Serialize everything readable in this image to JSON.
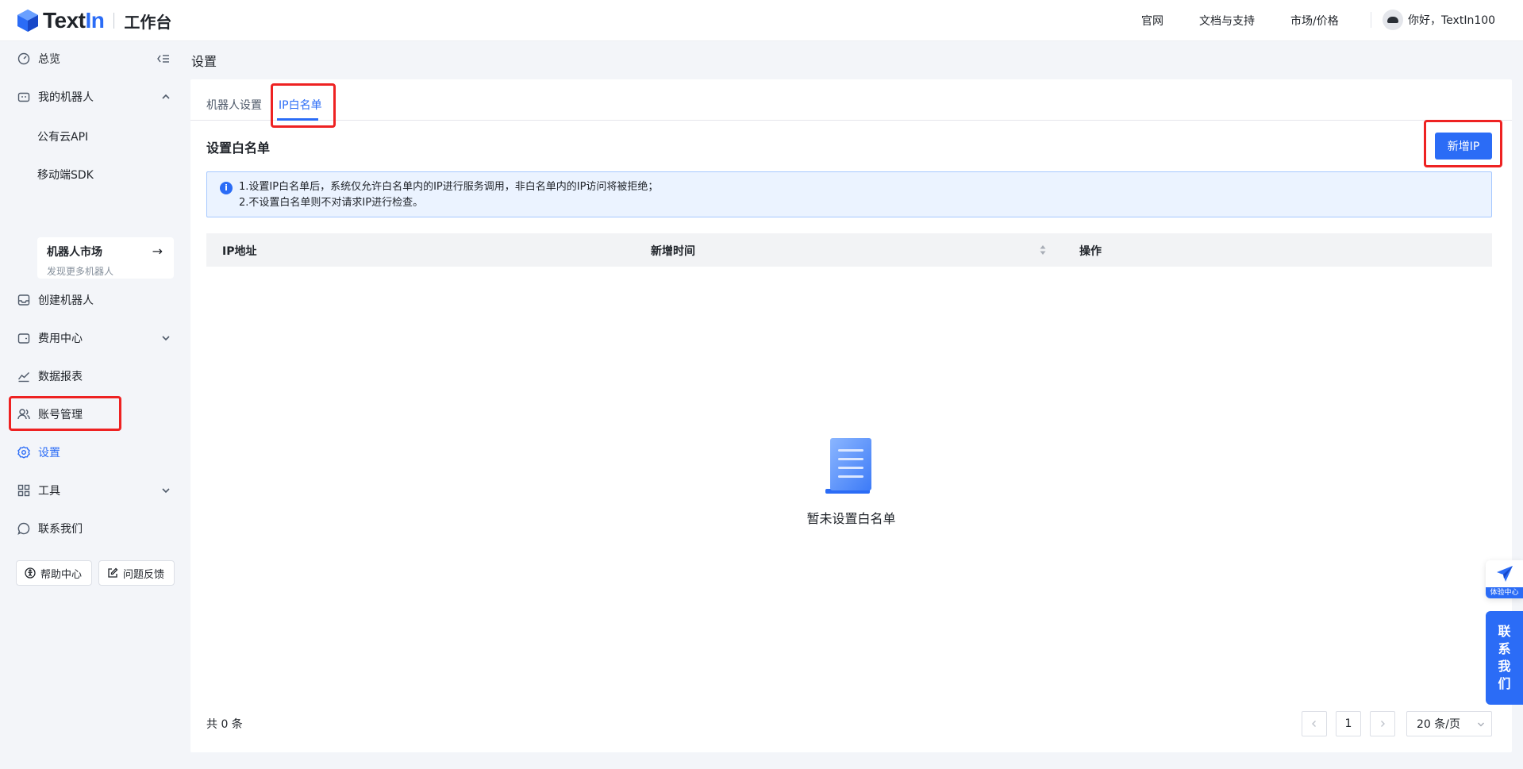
{
  "header": {
    "logo_text_1": "Text",
    "logo_text_2": "In",
    "workspace": "工作台",
    "nav": [
      "官网",
      "文档与支持",
      "市场/价格"
    ],
    "greeting": "你好，TextIn100"
  },
  "sidebar": {
    "overview": "总览",
    "my_robots": "我的机器人",
    "sub_items": [
      "公有云API",
      "移动端SDK"
    ],
    "market_title": "机器人市场",
    "market_sub": "发现更多机器人",
    "create_robot": "创建机器人",
    "billing": "费用中心",
    "reports": "数据报表",
    "accounts": "账号管理",
    "settings": "设置",
    "tools": "工具",
    "contact": "联系我们",
    "help_btn": "帮助中心",
    "feedback_btn": "问题反馈"
  },
  "page": {
    "title": "设置",
    "tabs": [
      "机器人设置",
      "IP白名单"
    ],
    "section_title": "设置白名单",
    "add_btn": "新增IP",
    "notice_line1": "1.设置IP白名单后，系统仅允许白名单内的IP进行服务调用，非白名单内的IP访问将被拒绝；",
    "notice_line2": "2.不设置白名单则不对请求IP进行检查。",
    "columns": [
      "IP地址",
      "新增时间",
      "操作"
    ],
    "empty_text": "暂未设置白名单",
    "total": "共 0 条",
    "page_num": "1",
    "page_size": "20 条/页"
  },
  "floating": {
    "experience": "体验中心",
    "contact_chars": [
      "联",
      "系",
      "我",
      "们"
    ]
  },
  "colors": {
    "accent": "#2b6cf6",
    "highlight": "#ee2222"
  }
}
